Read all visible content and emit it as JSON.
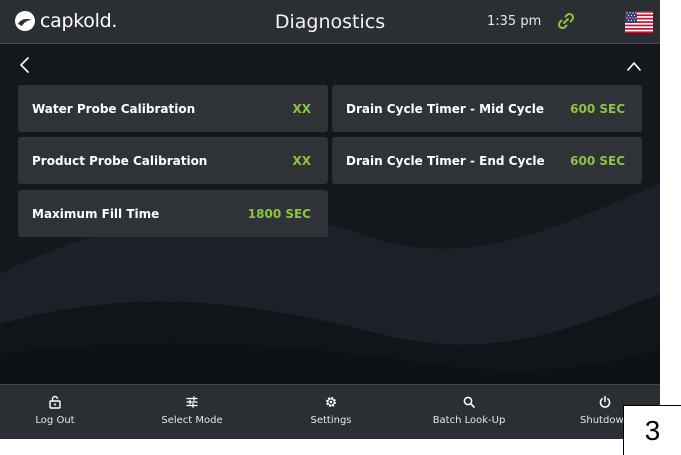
{
  "header": {
    "brand": "capkold.",
    "title": "Diagnostics",
    "time": "1:35 pm",
    "link_icon": "link-icon",
    "flag_icon": "us-flag-icon"
  },
  "subbar": {
    "back_icon": "chevron-left-icon",
    "collapse_icon": "chevron-up-icon"
  },
  "cards": [
    {
      "label": "Water Probe Calibration",
      "value": "XX"
    },
    {
      "label": "Product Probe Calibration",
      "value": "XX"
    },
    {
      "label": "Maximum Fill Time",
      "value": "1800 SEC"
    },
    {
      "label": "Drain Cycle Timer - Mid Cycle",
      "value": "600 SEC"
    },
    {
      "label": "Drain Cycle Timer - End Cycle",
      "value": "600 SEC"
    }
  ],
  "nav": [
    {
      "label": "Log Out",
      "icon": "unlock-icon"
    },
    {
      "label": "Select Mode",
      "icon": "sliders-icon"
    },
    {
      "label": "Settings",
      "icon": "gear-icon"
    },
    {
      "label": "Batch Look-Up",
      "icon": "search-icon"
    },
    {
      "label": "Shutdown",
      "icon": "power-icon"
    }
  ],
  "page_number": "3",
  "colors": {
    "accent_green": "#8cc540",
    "header_bg": "#2b2f33",
    "card_bg": "#2f3337",
    "screen_bg": "#15191d"
  }
}
